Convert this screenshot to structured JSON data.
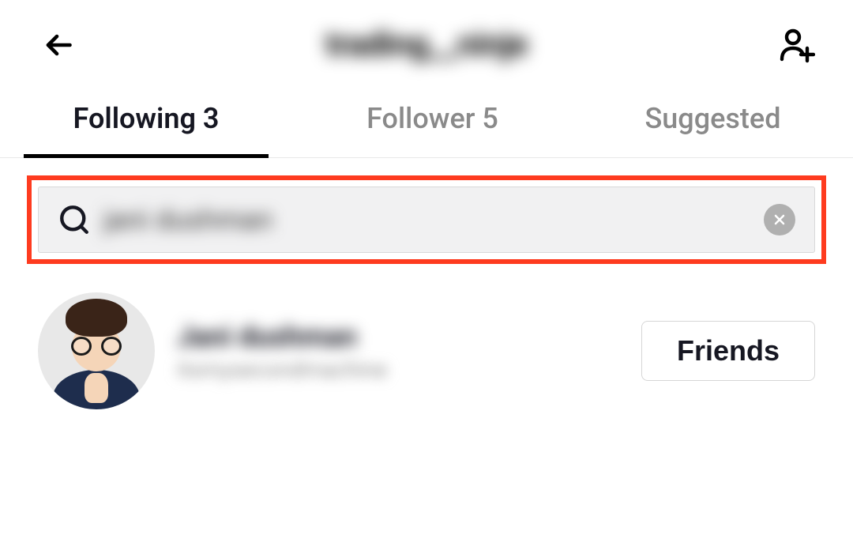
{
  "header": {
    "page_title": "trading__ninje"
  },
  "tabs": {
    "following": {
      "label": "Following 3"
    },
    "follower": {
      "label": "Follower 5"
    },
    "suggested": {
      "label": "Suggested"
    }
  },
  "search": {
    "value": "jani dushman"
  },
  "results": [
    {
      "name": "Jani dushman",
      "handle": "itsmysecondmachine",
      "button_label": "Friends"
    }
  ]
}
